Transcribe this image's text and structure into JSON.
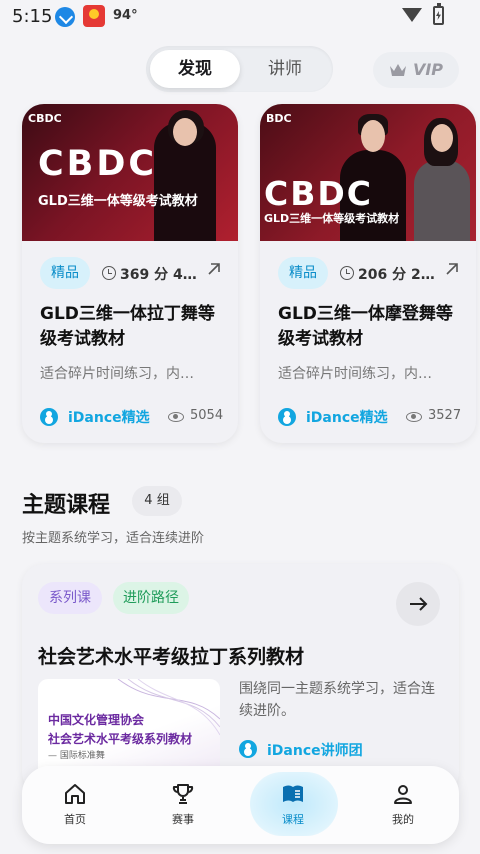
{
  "status_bar": {
    "time": "5:15",
    "temperature": "94°"
  },
  "top_tabs": [
    {
      "label": "发现",
      "active": true
    },
    {
      "label": "讲师",
      "active": false
    }
  ],
  "vip": {
    "label": "VIP"
  },
  "featured": [
    {
      "brand_small": "CBDC",
      "brand_big": "CBDC",
      "thumb_subtitle": "GLD三维一体等级考试教材",
      "tag": "精品",
      "duration": "369 分 4…",
      "title": "GLD三维一体拉丁舞等级考试教材",
      "desc": "适合碎片时间练习，内…",
      "author": "iDance精选",
      "views": "5054"
    },
    {
      "brand_small": "BDC",
      "brand_big": "CBDC",
      "thumb_subtitle": "GLD三维一体等级考试教材",
      "tag": "精品",
      "duration": "206 分 2…",
      "title": "GLD三维一体摩登舞等级考试教材",
      "desc": "适合碎片时间练习，内…",
      "author": "iDance精选",
      "views": "3527"
    }
  ],
  "section": {
    "title": "主题课程",
    "badge": "4 组",
    "subtitle": "按主题系统学习，适合连续进阶"
  },
  "series": {
    "pill_series": "系列课",
    "pill_path": "进阶路径",
    "title": "社会艺术水平考级拉丁系列教材",
    "thumb_line1": "中国文化管理协会",
    "thumb_line2": "社会艺术水平考级系列教材",
    "thumb_line3": "— 国际标准舞",
    "desc": "围绕同一主题系统学习，适合连续进阶。",
    "author": "iDance讲师团"
  },
  "bottom_nav": [
    {
      "label": "首页",
      "icon": "home-icon"
    },
    {
      "label": "赛事",
      "icon": "trophy-icon"
    },
    {
      "label": "课程",
      "icon": "book-icon",
      "active": true
    },
    {
      "label": "我的",
      "icon": "person-icon"
    }
  ],
  "colors": {
    "accent": "#12a6e0",
    "tag_bg": "#d7f1fb",
    "series_purple": "#7b5acb",
    "path_green": "#1f9c5a"
  }
}
